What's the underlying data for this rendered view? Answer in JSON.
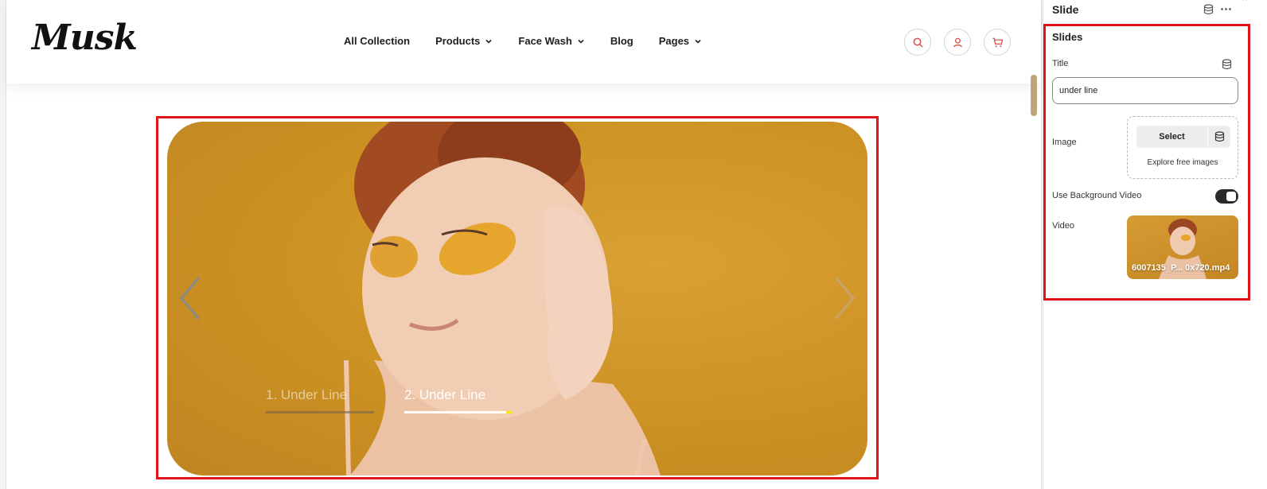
{
  "store": {
    "logo_text": "Musk",
    "nav": [
      {
        "label": "All Collection",
        "has_dropdown": false
      },
      {
        "label": "Products",
        "has_dropdown": true
      },
      {
        "label": "Face Wash",
        "has_dropdown": true
      },
      {
        "label": "Blog",
        "has_dropdown": false
      },
      {
        "label": "Pages",
        "has_dropdown": true
      }
    ],
    "icons": [
      "search-icon",
      "user-icon",
      "cart-icon"
    ],
    "accent_color": "#d9534f"
  },
  "hero": {
    "background_color": "#cc9123",
    "highlight_color": "#e0141a",
    "tabs": [
      {
        "label": "1. Under Line",
        "active": false
      },
      {
        "label": "2. Under Line",
        "active": true
      }
    ],
    "progress_color": "#f7e600"
  },
  "panel": {
    "title": "Slide",
    "section_label": "Slides",
    "title_field": {
      "label": "Title",
      "value": "under line"
    },
    "image_field": {
      "label": "Image",
      "select_label": "Select",
      "explore_label": "Explore free images"
    },
    "background_video": {
      "label": "Use Background Video",
      "enabled": true
    },
    "video_field": {
      "label": "Video",
      "filename": "6007135_P... 0x720.mp4"
    }
  }
}
